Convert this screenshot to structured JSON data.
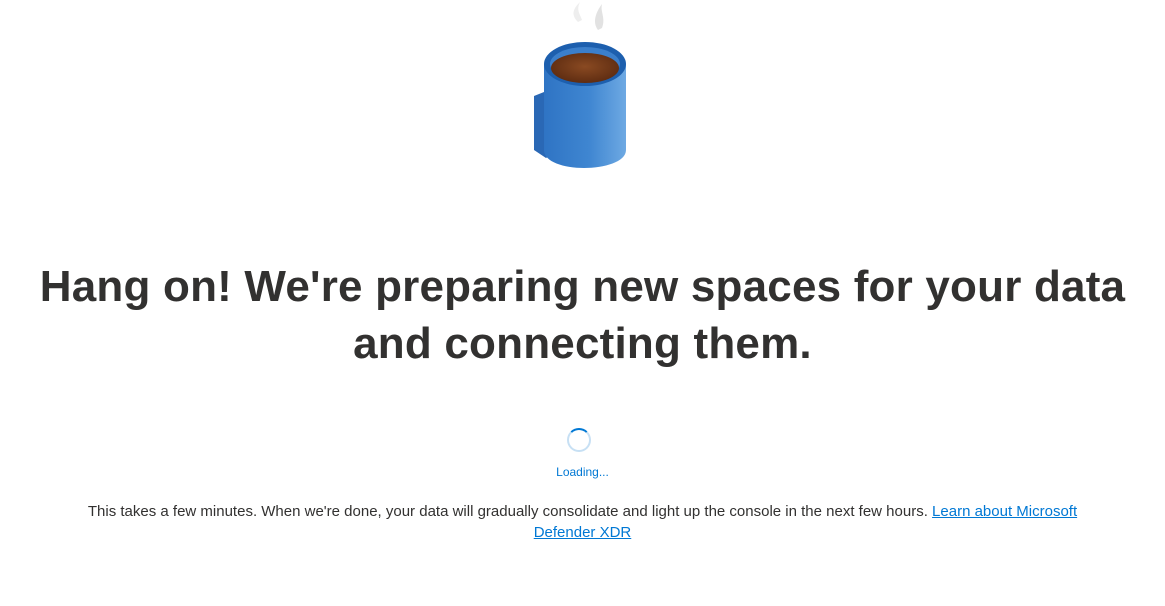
{
  "illustration": {
    "icon": "coffee-mug-icon",
    "colors": {
      "mug": "#3f86d1",
      "coffee": "#6b3416",
      "steam": "#e6e6e6"
    }
  },
  "title": "Hang on! We're preparing new spaces for your data and connecting them.",
  "loading": {
    "label": "Loading...",
    "color": "#0078d4"
  },
  "description": {
    "text": "This takes a few minutes. When we're done, your data will gradually consolidate and light up the console in the next few hours. ",
    "link_label": "Learn about Microsoft Defender XDR"
  }
}
